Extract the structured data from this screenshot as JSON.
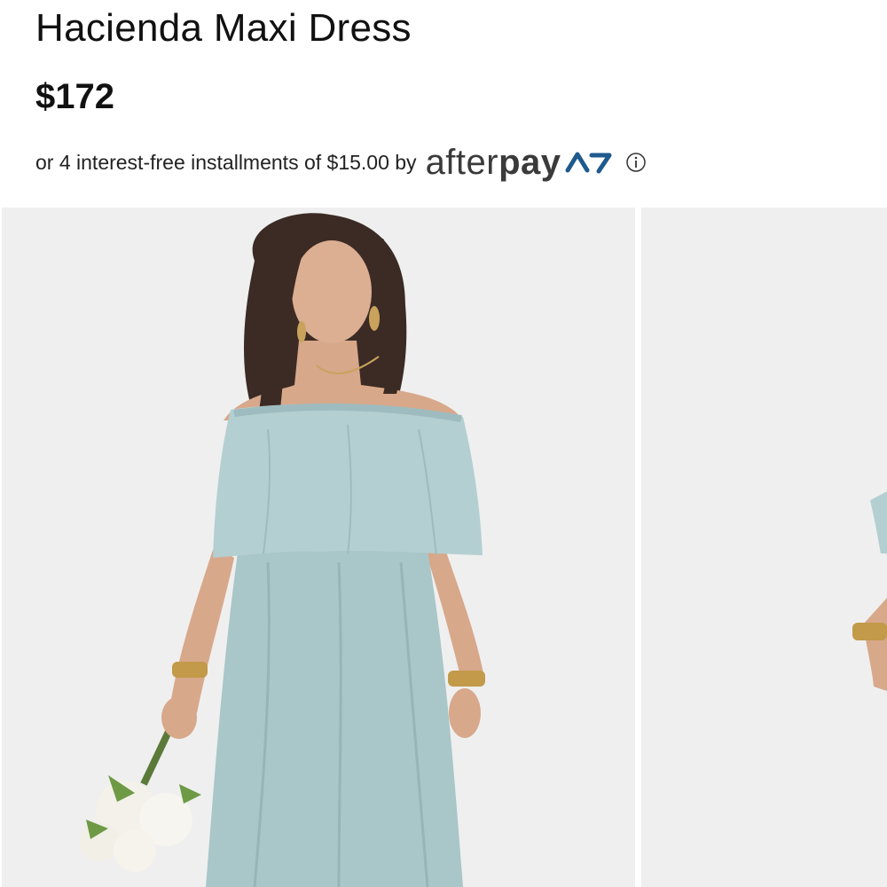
{
  "product": {
    "title": "Hacienda Maxi Dress",
    "price": "$172"
  },
  "installments": {
    "text": "or 4 interest-free installments of $15.00 by",
    "brand_light": "after",
    "brand_bold": "pay",
    "brand_icon": "afterpay-logo-icon",
    "info_icon": "info-icon"
  },
  "gallery": {
    "images": [
      {
        "alt": "Model wearing dusty blue off-the-shoulder maxi dress holding white bouquet",
        "icon": "photo"
      },
      {
        "alt": "Second product photo, partially visible",
        "icon": "photo"
      }
    ]
  },
  "colors": {
    "dress": "#a9c6c8",
    "background": "#efefef",
    "text": "#111111"
  }
}
